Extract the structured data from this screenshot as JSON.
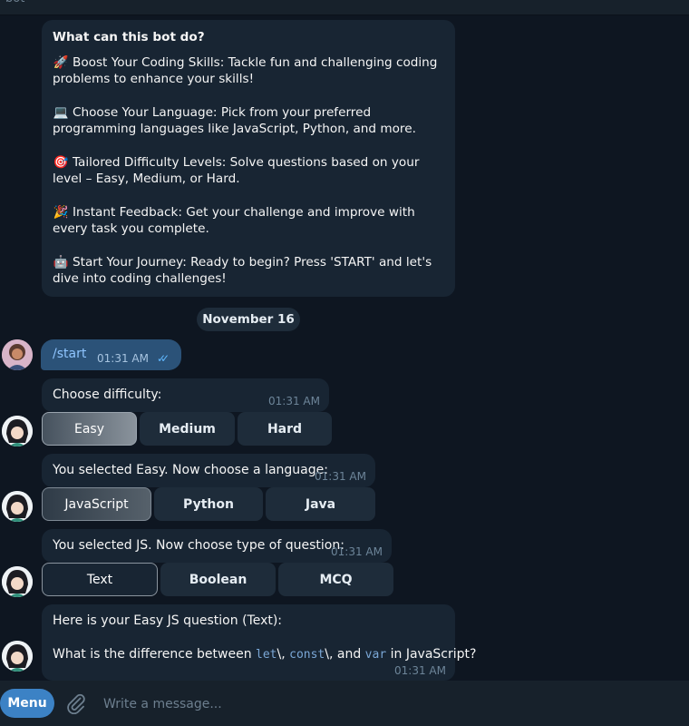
{
  "header": {
    "title": "bot"
  },
  "intro": {
    "heading": "What can this bot do?",
    "items": [
      {
        "icon": "rocket-icon",
        "glyph": "🚀",
        "text": "Boost Your Coding Skills: Tackle fun and challenging coding problems to enhance your skills!"
      },
      {
        "icon": "laptop-icon",
        "glyph": "💻",
        "text": "Choose Your Language: Pick from your preferred programming languages like JavaScript, Python, and more."
      },
      {
        "icon": "target-icon",
        "glyph": "🎯",
        "text": "Tailored Difficulty Levels: Solve questions based on your level – Easy, Medium, or Hard."
      },
      {
        "icon": "party-popper-icon",
        "glyph": "🎉",
        "text": "Instant Feedback: Get your challenge and improve with every task you complete."
      },
      {
        "icon": "robot-icon",
        "glyph": "🤖",
        "text": "Start Your Journey: Ready to begin? Press 'START' and let's dive into coding challenges!"
      }
    ]
  },
  "date_separator": "November 16",
  "outgoing": {
    "text": "/start",
    "time": "01:31 AM",
    "status": "read"
  },
  "messages": [
    {
      "text": "Choose difficulty:",
      "time": "01:31 AM",
      "buttons": [
        "Easy",
        "Medium",
        "Hard"
      ],
      "selected": "Easy"
    },
    {
      "text": "You selected Easy. Now choose a language:",
      "time": "01:31 AM",
      "buttons": [
        "JavaScript",
        "Python",
        "Java"
      ],
      "selected": "JavaScript"
    },
    {
      "text": "You selected JS. Now choose type of question:",
      "time": "01:31 AM",
      "buttons": [
        "Text",
        "Boolean",
        "MCQ"
      ],
      "selected": "Text"
    }
  ],
  "question": {
    "line1": "Here is your Easy JS question (Text):",
    "line2_prefix": "What is the difference between ",
    "code1": "let",
    "sep1": "\\, ",
    "code2": "const",
    "sep2": "\\, and ",
    "code3": "var",
    "suffix": " in JavaScript?",
    "time": "01:31 AM"
  },
  "composer": {
    "menu_label": "Menu",
    "placeholder": "Write a message..."
  },
  "colors": {
    "background": "#0e1621",
    "bubble_in": "#182533",
    "bubble_out": "#2b5278",
    "accent": "#3c82c5",
    "code": "#7aa7d6"
  }
}
